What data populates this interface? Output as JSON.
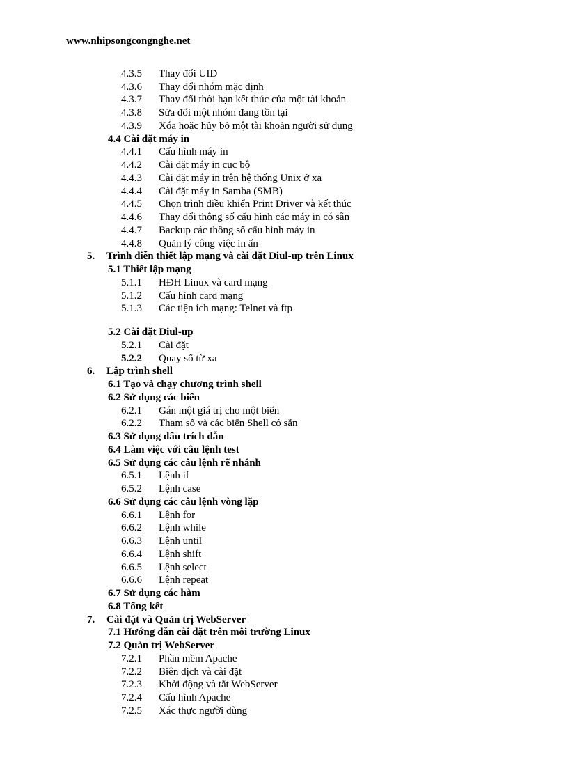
{
  "header": "www.nhipsongcongnghe.net",
  "toc": [
    {
      "type": "sub",
      "num": "4.3.5",
      "text": "Thay đổi UID"
    },
    {
      "type": "sub",
      "num": "4.3.6",
      "text": "Thay đổi nhóm mặc định"
    },
    {
      "type": "sub",
      "num": "4.3.7",
      "text": "Thay đổi thời hạn kết thúc của một tài khoản"
    },
    {
      "type": "sub",
      "num": "4.3.8",
      "text": "Sửa đổi một nhóm đang tồn tại"
    },
    {
      "type": "sub",
      "num": "4.3.9",
      "text": "Xóa hoặc hủy bỏ một tài khoản người sử dụng"
    },
    {
      "type": "sec",
      "text": "4.4 Cài đặt máy in"
    },
    {
      "type": "sub",
      "num": "4.4.1",
      "text": "Cấu hình máy in"
    },
    {
      "type": "sub",
      "num": "4.4.2",
      "text": "Cài đặt máy in cục bộ"
    },
    {
      "type": "sub",
      "num": "4.4.3",
      "text": "Cài đặt máy in trên hệ thống Unix ở xa"
    },
    {
      "type": "sub",
      "num": "4.4.4",
      "text": "Cài đặt máy in Samba (SMB)"
    },
    {
      "type": "sub",
      "num": "4.4.5",
      "text": "Chọn trình điều khiển Print Driver và kết thúc"
    },
    {
      "type": "sub",
      "num": "4.4.6",
      "text": "Thay đổi thông số cấu hình các máy in có sẵn"
    },
    {
      "type": "sub",
      "num": "4.4.7",
      "text": "Backup các thông số cấu hình máy in"
    },
    {
      "type": "sub",
      "num": "4.4.8",
      "text": "Quản lý công việc in ấn"
    },
    {
      "type": "chapter",
      "num": "5.",
      "text": "Trình diễn thiết lập mạng và cài đặt Diul-up trên Linux"
    },
    {
      "type": "sec",
      "text": "5.1 Thiết lập mạng"
    },
    {
      "type": "sub",
      "num": "5.1.1",
      "text": "HĐH Linux và card mạng"
    },
    {
      "type": "sub",
      "num": "5.1.2",
      "text": "Cấu hình card mạng"
    },
    {
      "type": "sub",
      "num": "5.1.3",
      "text": "Các tiện ích mạng: Telnet và ftp"
    },
    {
      "type": "gap"
    },
    {
      "type": "sec",
      "text": "5.2 Cài đặt Diul-up"
    },
    {
      "type": "sub",
      "num": "5.2.1",
      "text": "Cài đặt"
    },
    {
      "type": "sub",
      "num": "5.2.2",
      "bold": true,
      "text": "Quay số từ xa"
    },
    {
      "type": "chapter",
      "num": "6.",
      "text": "Lập trình shell"
    },
    {
      "type": "sec",
      "text": "6.1 Tạo và chạy chương trình shell"
    },
    {
      "type": "sec",
      "text": "6.2 Sử dụng các biến"
    },
    {
      "type": "sub",
      "num": "6.2.1",
      "text": "Gán một giá trị cho một biến"
    },
    {
      "type": "sub",
      "num": "6.2.2",
      "text": "Tham số và các biến Shell có sẵn"
    },
    {
      "type": "sec",
      "text": "6.3 Sử dụng dấu trích dẫn"
    },
    {
      "type": "sec",
      "text": "6.4 Làm việc với câu lệnh test"
    },
    {
      "type": "sec",
      "text": "6.5 Sử dụng các câu lệnh rẽ nhánh"
    },
    {
      "type": "sub",
      "num": "6.5.1",
      "text": "Lệnh if"
    },
    {
      "type": "sub",
      "num": "6.5.2",
      "text": "Lệnh case"
    },
    {
      "type": "sec",
      "text": "6.6 Sử dụng các câu lệnh vòng lặp"
    },
    {
      "type": "sub",
      "num": "6.6.1",
      "text": "Lệnh for"
    },
    {
      "type": "sub",
      "num": "6.6.2",
      "text": "Lệnh while"
    },
    {
      "type": "sub",
      "num": "6.6.3",
      "text": "Lệnh until"
    },
    {
      "type": "sub",
      "num": "6.6.4",
      "text": "Lệnh shift"
    },
    {
      "type": "sub",
      "num": "6.6.5",
      "text": "Lệnh select"
    },
    {
      "type": "sub",
      "num": "6.6.6",
      "text": "Lệnh repeat"
    },
    {
      "type": "sec",
      "text": "6.7 Sử dụng các hàm"
    },
    {
      "type": "sec",
      "text": "6.8 Tổng kết"
    },
    {
      "type": "chapter",
      "num": "7.",
      "text": "Cài đặt và Quản trị WebServer"
    },
    {
      "type": "sec",
      "text": "7.1 Hướng dẫn cài đặt trên môi trường Linux"
    },
    {
      "type": "sec",
      "text": "7.2 Quản trị WebServer"
    },
    {
      "type": "sub",
      "num": "7.2.1",
      "text": "Phần mềm Apache"
    },
    {
      "type": "sub",
      "num": "7.2.2",
      "text": "Biên dịch và cài đặt"
    },
    {
      "type": "sub",
      "num": "7.2.3",
      "text": "Khởi động và tắt WebServer"
    },
    {
      "type": "sub",
      "num": "7.2.4",
      "text": "Cấu hình Apache"
    },
    {
      "type": "sub",
      "num": "7.2.5",
      "text": "Xác thực người dùng"
    }
  ]
}
